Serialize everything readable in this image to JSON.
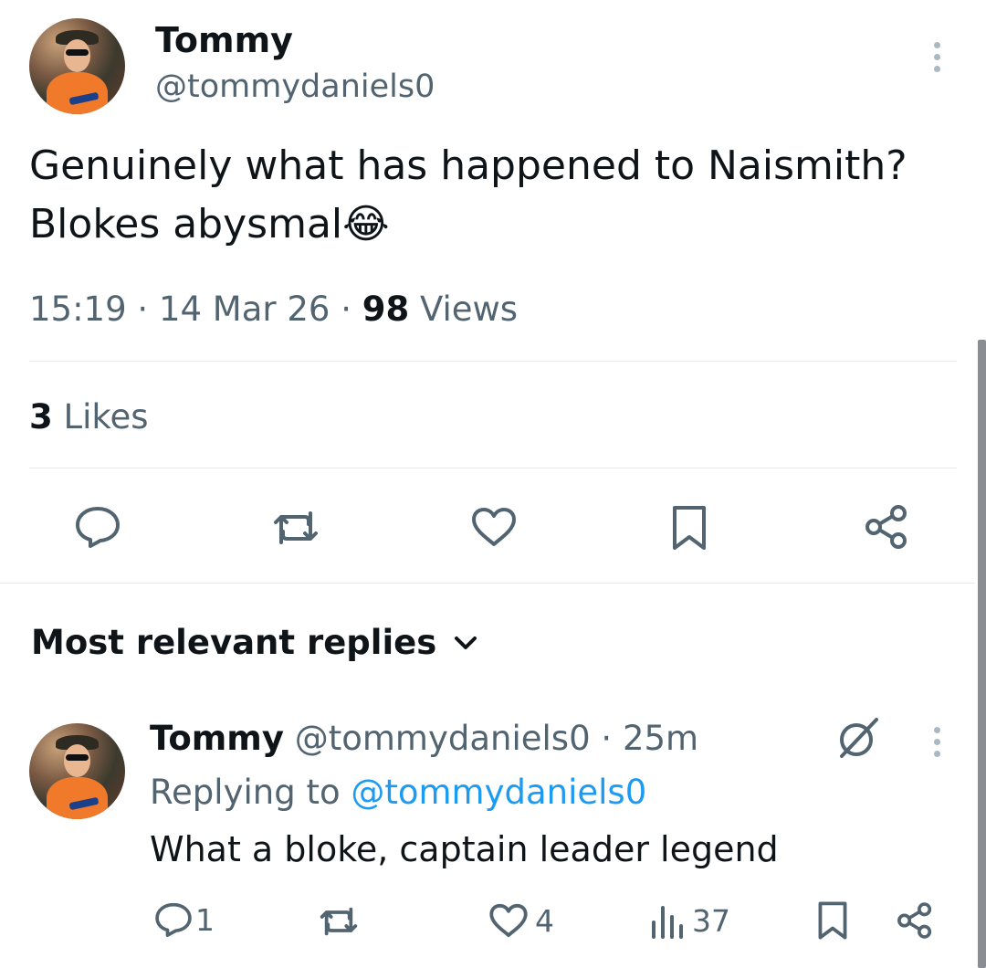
{
  "tweet": {
    "author_name": "Tommy",
    "author_handle": "@tommydaniels0",
    "text_line1": "Genuinely what has happened to Naismith?",
    "text_line2": "Blokes abysmal",
    "emoji": "😂",
    "time": "15:19",
    "sep1": "·",
    "date": "14 Mar 26",
    "sep2": "·",
    "views_count": "98",
    "views_label": "Views",
    "likes_count": "3",
    "likes_label": "Likes"
  },
  "actions": {
    "icons": [
      "reply-icon",
      "retweet-icon",
      "like-icon",
      "bookmark-icon",
      "share-icon"
    ]
  },
  "replies_header": {
    "label": "Most relevant replies"
  },
  "reply": {
    "author_name": "Tommy",
    "author_handle": "@tommydaniels0",
    "sep": "·",
    "age": "25m",
    "replying_prefix": "Replying to",
    "replying_handle": "@tommydaniels0",
    "text": "What a bloke, captain leader legend",
    "reply_count": "1",
    "like_count": "4",
    "view_count": "37"
  },
  "colors": {
    "text": "#0f1419",
    "secondary": "#536471",
    "accent": "#1d9bf0",
    "divider": "#e6e9ec"
  }
}
